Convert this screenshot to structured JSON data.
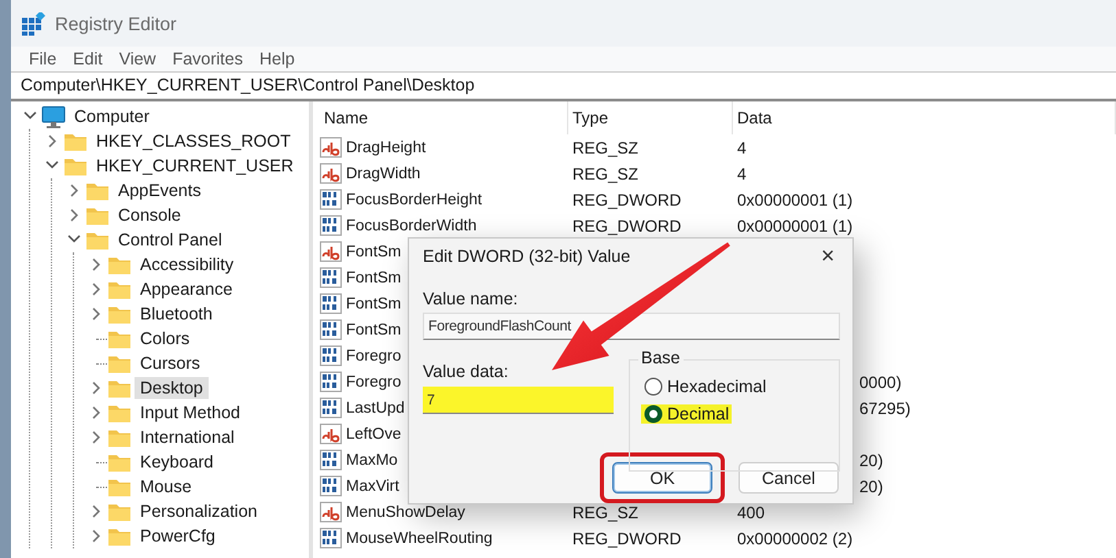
{
  "window": {
    "title": "Registry Editor"
  },
  "menu": [
    "File",
    "Edit",
    "View",
    "Favorites",
    "Help"
  ],
  "address": "Computer\\HKEY_CURRENT_USER\\Control Panel\\Desktop",
  "tree": [
    {
      "label": "Computer",
      "kind": "computer",
      "expandable": true,
      "expanded": true,
      "selected": false,
      "children": [
        {
          "label": "HKEY_CLASSES_ROOT",
          "kind": "folder",
          "expandable": true,
          "expanded": false,
          "selected": false
        },
        {
          "label": "HKEY_CURRENT_USER",
          "kind": "folder",
          "expandable": true,
          "expanded": true,
          "selected": false,
          "children": [
            {
              "label": "AppEvents",
              "kind": "folder",
              "expandable": true,
              "expanded": false,
              "selected": false
            },
            {
              "label": "Console",
              "kind": "folder",
              "expandable": true,
              "expanded": false,
              "selected": false
            },
            {
              "label": "Control Panel",
              "kind": "folder",
              "expandable": true,
              "expanded": true,
              "selected": false,
              "children": [
                {
                  "label": "Accessibility",
                  "kind": "folder",
                  "expandable": true,
                  "expanded": false,
                  "selected": false
                },
                {
                  "label": "Appearance",
                  "kind": "folder",
                  "expandable": true,
                  "expanded": false,
                  "selected": false
                },
                {
                  "label": "Bluetooth",
                  "kind": "folder",
                  "expandable": true,
                  "expanded": false,
                  "selected": false
                },
                {
                  "label": "Colors",
                  "kind": "folder",
                  "expandable": false,
                  "selected": false
                },
                {
                  "label": "Cursors",
                  "kind": "folder",
                  "expandable": false,
                  "selected": false
                },
                {
                  "label": "Desktop",
                  "kind": "folder",
                  "expandable": true,
                  "expanded": false,
                  "selected": true
                },
                {
                  "label": "Input Method",
                  "kind": "folder",
                  "expandable": true,
                  "expanded": false,
                  "selected": false
                },
                {
                  "label": "International",
                  "kind": "folder",
                  "expandable": true,
                  "expanded": false,
                  "selected": false
                },
                {
                  "label": "Keyboard",
                  "kind": "folder",
                  "expandable": false,
                  "selected": false
                },
                {
                  "label": "Mouse",
                  "kind": "folder",
                  "expandable": false,
                  "selected": false
                },
                {
                  "label": "Personalization",
                  "kind": "folder",
                  "expandable": true,
                  "expanded": false,
                  "selected": false
                },
                {
                  "label": "PowerCfg",
                  "kind": "folder",
                  "expandable": true,
                  "expanded": false,
                  "selected": false
                }
              ]
            }
          ]
        }
      ]
    }
  ],
  "list": {
    "columns": [
      "Name",
      "Type",
      "Data"
    ],
    "rows": [
      {
        "kind": "string",
        "name": "DragHeight",
        "type": "REG_SZ",
        "data": "4"
      },
      {
        "kind": "string",
        "name": "DragWidth",
        "type": "REG_SZ",
        "data": "4"
      },
      {
        "kind": "dword",
        "name": "FocusBorderHeight",
        "type": "REG_DWORD",
        "data": "0x00000001 (1)"
      },
      {
        "kind": "dword",
        "name": "FocusBorderWidth",
        "type": "REG_DWORD",
        "data": "0x00000001 (1)"
      },
      {
        "kind": "string",
        "name": "FontSm"
      },
      {
        "kind": "dword",
        "name": "FontSm"
      },
      {
        "kind": "dword",
        "name": "FontSm"
      },
      {
        "kind": "dword",
        "name": "FontSm"
      },
      {
        "kind": "dword",
        "name": "Foregro"
      },
      {
        "kind": "dword",
        "name": "Foregro",
        "data": "0000)"
      },
      {
        "kind": "dword",
        "name": "LastUpd",
        "data": "67295)"
      },
      {
        "kind": "string",
        "name": "LeftOve"
      },
      {
        "kind": "dword",
        "name": "MaxMo",
        "data": "20)"
      },
      {
        "kind": "dword",
        "name": "MaxVirt",
        "data": "20)"
      },
      {
        "kind": "string",
        "name": "MenuShowDelay",
        "type": "REG_SZ",
        "data": "400"
      },
      {
        "kind": "dword",
        "name": "MouseWheelRouting",
        "type": "REG_DWORD",
        "data": "0x00000002 (2)"
      }
    ]
  },
  "dialog": {
    "title": "Edit DWORD (32-bit) Value",
    "close": "×",
    "value_name": {
      "label": "Value name:",
      "value": "ForegroundFlashCount"
    },
    "value_data": {
      "label": "Value data:",
      "value": "7",
      "highlighted": true
    },
    "base": {
      "label": "Base",
      "options": [
        {
          "label": "Hexadecimal",
          "selected": false,
          "highlighted": false
        },
        {
          "label": "Decimal",
          "selected": true,
          "highlighted": true
        }
      ]
    },
    "buttons": [
      {
        "label": "OK",
        "default": true,
        "circled": true
      },
      {
        "label": "Cancel",
        "default": false,
        "circled": false
      }
    ]
  }
}
